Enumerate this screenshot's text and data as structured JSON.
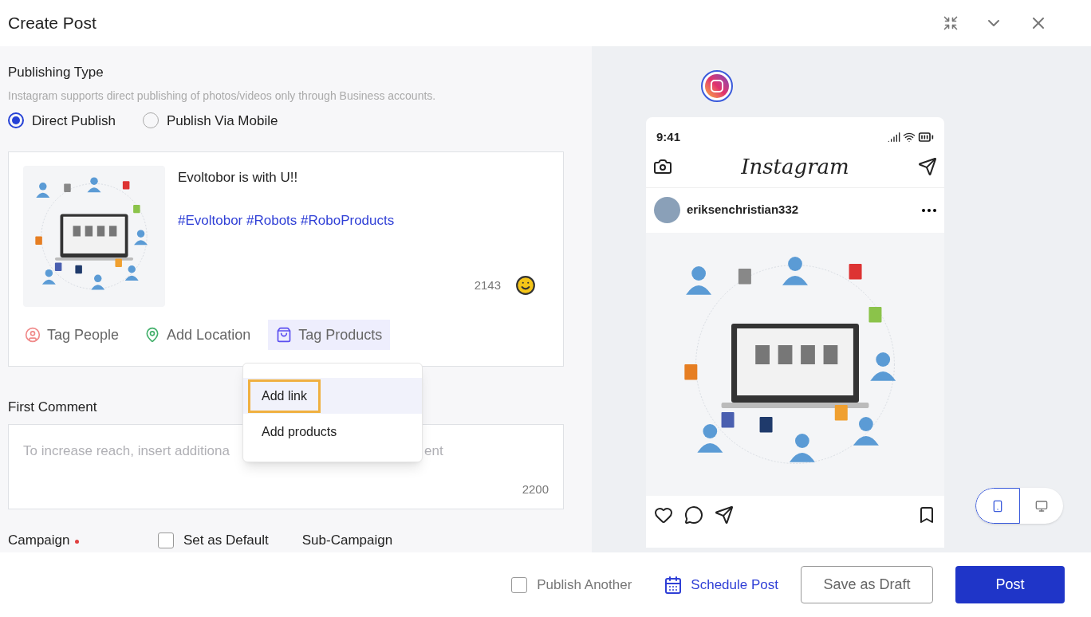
{
  "header": {
    "title": "Create Post"
  },
  "publishing_type": {
    "label": "Publishing Type",
    "hint": "Instagram supports direct publishing of photos/videos only through Business accounts.",
    "options": [
      {
        "label": "Direct Publish",
        "selected": true
      },
      {
        "label": "Publish Via Mobile",
        "selected": false
      }
    ]
  },
  "post": {
    "caption": "Evoltobor is with U!!",
    "hashtags": "#Evoltobor #Robots #RoboProducts",
    "count": "2143",
    "actions": [
      {
        "label": "Tag People",
        "kind": "person",
        "selected": false
      },
      {
        "label": "Add Location",
        "kind": "location",
        "selected": false
      },
      {
        "label": "Tag Products",
        "kind": "bag",
        "selected": true
      }
    ],
    "menu": {
      "items": [
        {
          "label": "Add link",
          "selected": true
        },
        {
          "label": "Add products",
          "selected": false
        }
      ]
    }
  },
  "first_comment": {
    "label": "First Comment",
    "placeholder_parts": [
      "To increase reach, insert additiona",
      "ent"
    ],
    "count": "2200"
  },
  "campaign_row": {
    "campaign_label": "Campaign",
    "required": true,
    "set_default": {
      "label": "Set as Default",
      "checked": false
    },
    "sub_campaign_label": "Sub-Campaign"
  },
  "preview": {
    "time": "9:41",
    "app_name": "Instagram",
    "username": "eriksenchristian332",
    "devices": [
      {
        "kind": "mobile",
        "selected": true
      },
      {
        "kind": "desktop",
        "selected": false
      }
    ]
  },
  "footer": {
    "publish_another": {
      "label": "Publish Another",
      "checked": false
    },
    "schedule": "Schedule Post",
    "draft": "Save as Draft",
    "post": "Post"
  }
}
